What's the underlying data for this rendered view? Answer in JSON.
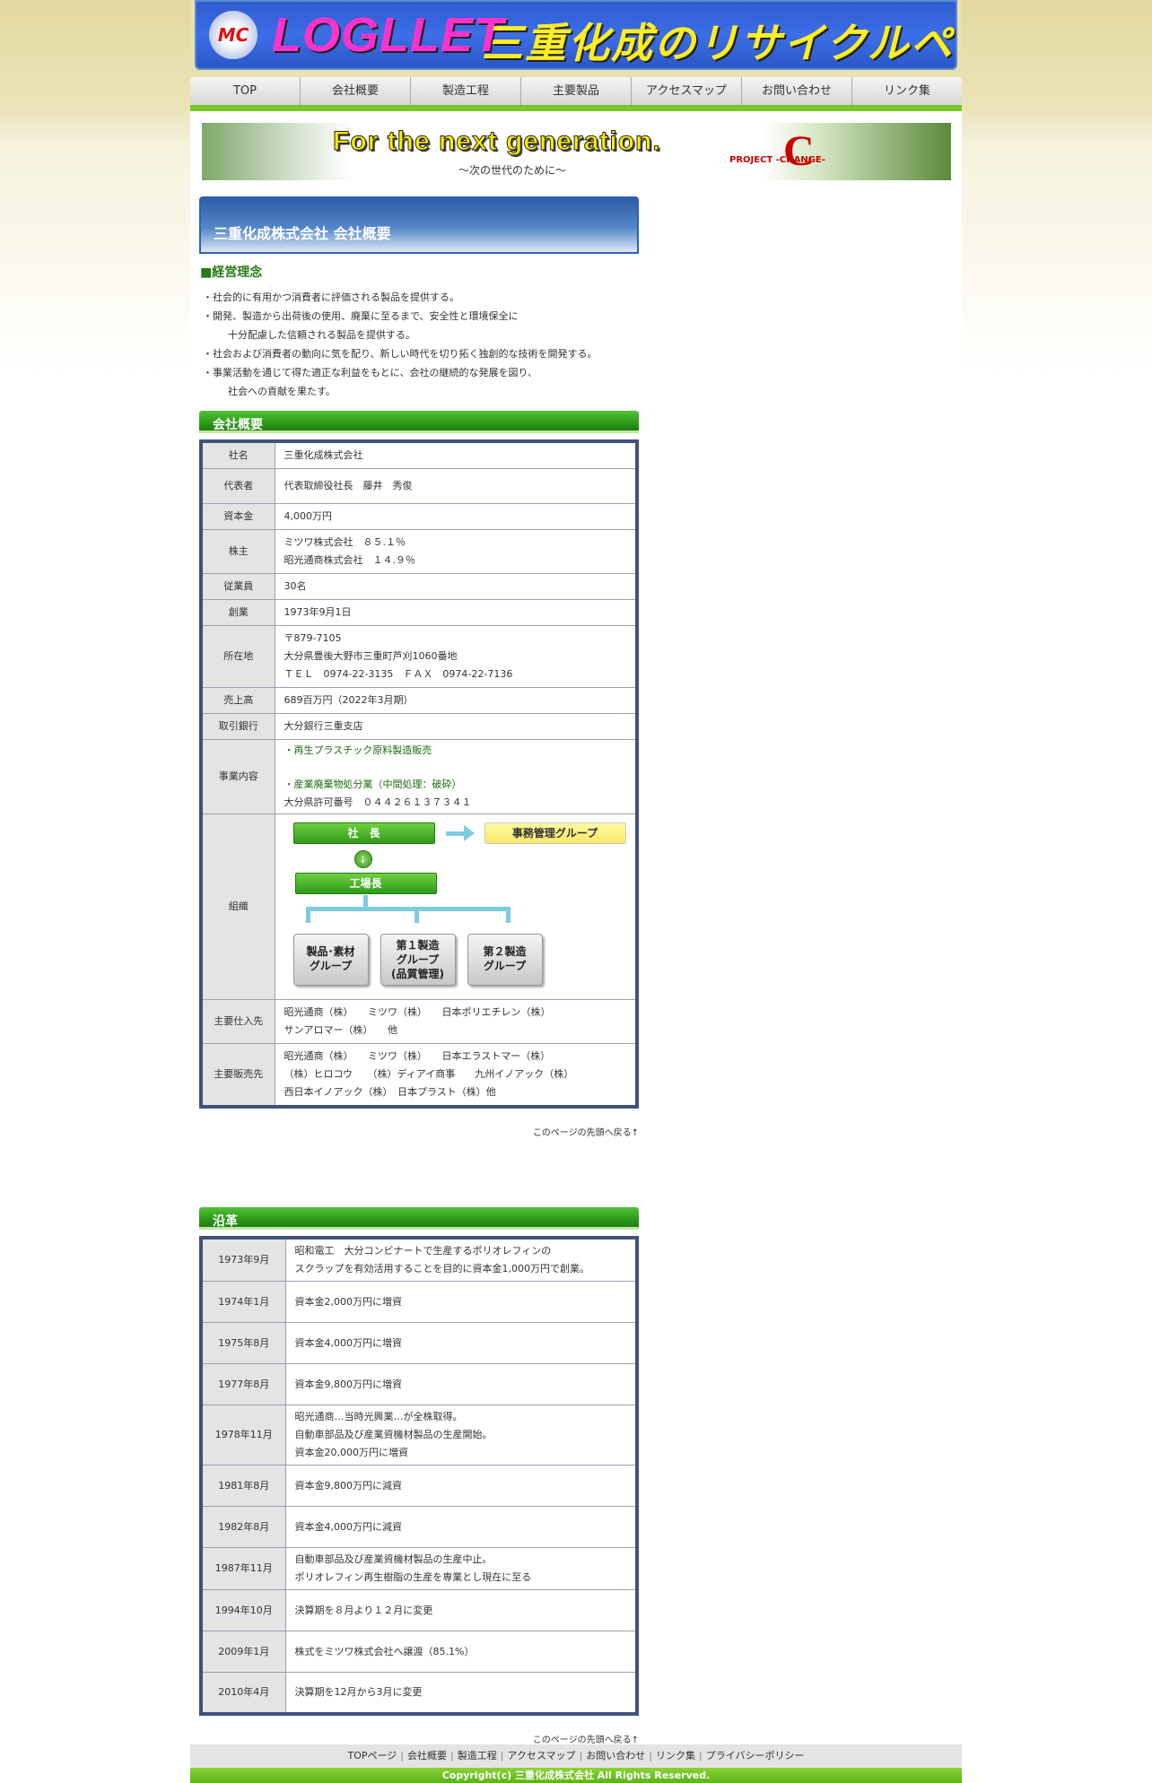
{
  "header": {
    "logo_mark": "MC",
    "logo_text": "LOGLLET",
    "logo_sub": "三重化成のリサイクルペレット"
  },
  "nav": [
    "TOP",
    "会社概要",
    "製造工程",
    "主要製品",
    "アクセスマップ",
    "お問い合わせ",
    "リンク集"
  ],
  "hero": {
    "tagline": "For the next generation.",
    "tagline_sub": "〜次の世代のために〜",
    "project": "PROJECT -CHANGE-",
    "project_letter": "C"
  },
  "page_title": "三重化成株式会社 会社概要",
  "philosophy": {
    "heading": "■経営理念",
    "items": [
      [
        "・社会的に有用かつ消費者に評価される製品を提供する。"
      ],
      [
        "・開発、製造から出荷後の使用、廃棄に至るまで、安全性と環境保全に",
        "十分配慮した信頼される製品を提供する。"
      ],
      [
        "・社会および消費者の動向に気を配り、新しい時代を切り拓く独創的な技術を開発する。"
      ],
      [
        "・事業活動を通じて得た適正な利益をもとに、会社の継続的な発展を図り、",
        "社会への貢献を果たす。"
      ]
    ]
  },
  "overview": {
    "heading": "会社概要",
    "rows": [
      {
        "label": "社名",
        "lines": [
          "三重化成株式会社"
        ]
      },
      {
        "label": "代表者",
        "lines": [
          "代表取締役社長　藤井　秀俊"
        ]
      },
      {
        "label": "資本金",
        "lines": [
          "4,000万円"
        ]
      },
      {
        "label": "株主",
        "lines": [
          "ミツワ株式会社　８５.１％",
          "昭光通商株式会社　１４.９％"
        ]
      },
      {
        "label": "従業員",
        "lines": [
          "30名"
        ]
      },
      {
        "label": "創業",
        "lines": [
          "1973年9月1日"
        ]
      },
      {
        "label": "所在地",
        "lines": [
          "〒879-7105",
          "大分県豊後大野市三重町芦刈1060番地",
          "ＴＥＬ　0974-22-3135　ＦＡＸ　0974-22-7136"
        ]
      },
      {
        "label": "売上高",
        "lines": [
          "689百万円（2022年3月期）"
        ]
      },
      {
        "label": "取引銀行",
        "lines": [
          "大分銀行三重支店"
        ]
      }
    ],
    "business": {
      "label": "事業内容",
      "line1": "・再生プラスチック原料製造販売",
      "line2": "・産業廃棄物処分業（中間処理：破砕）",
      "line3": "大分県許可番号　０４４２６１３７３４１"
    },
    "org": {
      "label": "組織",
      "president": "社　長",
      "office": "事務管理グループ",
      "factory_head": "工場長",
      "group1": [
        "製品･素材",
        "グループ"
      ],
      "group2": [
        "第１製造",
        "グループ",
        "(品質管理)"
      ],
      "group3": [
        "第２製造",
        "グループ"
      ]
    },
    "suppliers": {
      "label": "主要仕入先",
      "lines": [
        "昭光通商（株）　　ミツワ（株）　　日本ポリエチレン（株）",
        "サンアロマー（株）　　他"
      ]
    },
    "customers": {
      "label": "主要販売先",
      "lines": [
        "昭光通商（株）　　ミツワ（株）　　日本エラストマー（株）",
        "（株）ヒロコウ　　（株）ディアイ商事　　九州イノアック（株）",
        "西日本イノアック（株）　日本プラスト（株）他"
      ]
    }
  },
  "to_top": "このページの先頭へ戻る↑",
  "history": {
    "heading": "沿革",
    "rows": [
      {
        "date": "1973年9月",
        "lines": [
          "昭和電工　大分コンビナートで生産するポリオレフィンの",
          "スクラップを有効活用することを目的に資本金1,000万円で創業。"
        ]
      },
      {
        "date": "1974年1月",
        "lines": [
          "資本金2,000万円に増資"
        ]
      },
      {
        "date": "1975年8月",
        "lines": [
          "資本金4,000万円に増資"
        ]
      },
      {
        "date": "1977年8月",
        "lines": [
          "資本金9,800万円に増資"
        ]
      },
      {
        "date": "1978年11月",
        "lines": [
          "昭光通商…当時光興業…が全株取得。",
          "自動車部品及び産業資機材製品の生産開始。",
          "資本金20,000万円に増資"
        ]
      },
      {
        "date": "1981年8月",
        "lines": [
          "資本金9,800万円に減資"
        ]
      },
      {
        "date": "1982年8月",
        "lines": [
          "資本金4,000万円に減資"
        ]
      },
      {
        "date": "1987年11月",
        "lines": [
          "自動車部品及び産業資機材製品の生産中止。",
          "ポリオレフィン再生樹脂の生産を専業とし現在に至る"
        ]
      },
      {
        "date": "1994年10月",
        "lines": [
          "決算期を８月より１２月に変更"
        ]
      },
      {
        "date": "2009年1月",
        "lines": [
          "株式をミツワ株式会社へ譲渡（85.1%）"
        ]
      },
      {
        "date": "2010年4月",
        "lines": [
          "決算期を12月から3月に変更"
        ]
      }
    ]
  },
  "footer": {
    "links": [
      "TOPページ",
      "会社概要",
      "製造工程",
      "アクセスマップ",
      "お問い合わせ",
      "リンク集",
      "プライバシーポリシー"
    ],
    "separator": "|",
    "copyright": "Copyright(c) 三重化成株式会社 All Rights Reserved."
  }
}
